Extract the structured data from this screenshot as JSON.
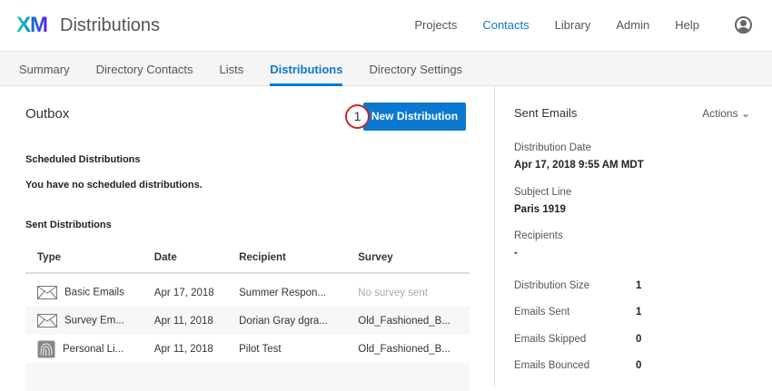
{
  "header": {
    "logo": "XM",
    "title": "Distributions",
    "nav": [
      "Projects",
      "Contacts",
      "Library",
      "Admin",
      "Help"
    ],
    "active_nav": "Contacts"
  },
  "tabs": [
    "Summary",
    "Directory Contacts",
    "Lists",
    "Distributions",
    "Directory Settings"
  ],
  "outbox": {
    "title": "Outbox",
    "new_button": "New Distribution",
    "step": "1",
    "scheduled_heading": "Scheduled Distributions",
    "scheduled_empty": "You have no scheduled distributions.",
    "sent_heading": "Sent Distributions",
    "columns": [
      "Type",
      "Date",
      "Recipient",
      "Survey"
    ],
    "rows": [
      {
        "icon": "envelope-icon",
        "type": "Basic Emails",
        "date": "Apr 17, 2018",
        "recipient": "Summer Respon...",
        "survey": "No survey sent"
      },
      {
        "icon": "envelope-icon",
        "type": "Survey Em...",
        "date": "Apr 11, 2018",
        "recipient": "Dorian Gray dgra...",
        "survey": "Old_Fashioned_B..."
      },
      {
        "icon": "fingerprint-icon",
        "type": "Personal Li...",
        "date": "Apr 11, 2018",
        "recipient": "Pilot Test",
        "survey": "Old_Fashioned_B..."
      }
    ]
  },
  "details": {
    "title": "Sent Emails",
    "actions": "Actions",
    "fields": [
      {
        "label": "Distribution Date",
        "value": "Apr 17, 2018 9:55 AM MDT"
      },
      {
        "label": "Subject Line",
        "value": "Paris 1919"
      },
      {
        "label": "Recipients",
        "value": "-"
      }
    ],
    "stats": [
      {
        "label": "Distribution Size",
        "value": "1"
      },
      {
        "label": "Emails Sent",
        "value": "1"
      },
      {
        "label": "Emails Skipped",
        "value": "0"
      },
      {
        "label": "Emails Bounced",
        "value": "0"
      }
    ]
  }
}
